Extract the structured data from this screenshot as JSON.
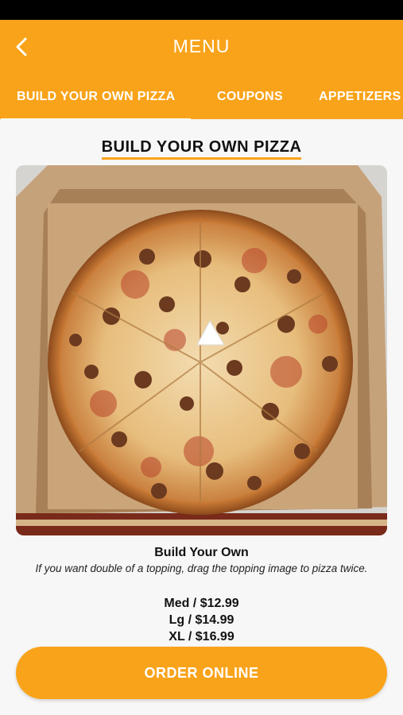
{
  "header": {
    "title": "MENU",
    "back_icon": "chevron-left-icon"
  },
  "tabs": [
    {
      "label": "BUILD YOUR OWN PIZZA",
      "active": true
    },
    {
      "label": "COUPONS",
      "active": false
    },
    {
      "label": "APPETIZERS",
      "active": false
    }
  ],
  "section": {
    "title": "BUILD YOUR OWN PIZZA"
  },
  "item": {
    "name": "Build Your Own",
    "description": "If you want double of a topping, drag the topping image to pizza twice.",
    "prices": [
      "Med / $12.99",
      "Lg / $14.99",
      "XL / $16.99"
    ]
  },
  "order_button": {
    "label": "ORDER ONLINE"
  },
  "colors": {
    "accent": "#f9a31a",
    "status_bar": "#000000",
    "background": "#f7f7f7"
  }
}
